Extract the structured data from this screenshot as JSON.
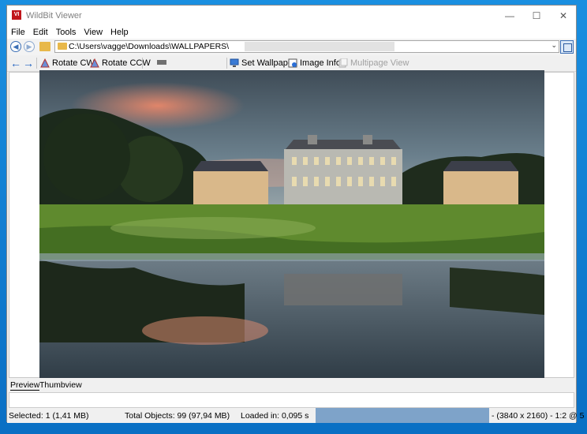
{
  "window": {
    "title": "WildBit Viewer",
    "app_icon_text": "VI",
    "controls": {
      "minimize": "—",
      "maximize": "☐",
      "close": "✕"
    }
  },
  "menu": [
    "File",
    "Edit",
    "Tools",
    "View",
    "Help"
  ],
  "address": {
    "path": "C:\\Users\\vagge\\Downloads\\WALLPAPERS\\",
    "dropdown": "⌄"
  },
  "toolbar": {
    "back": "←",
    "forward": "→",
    "rotate_cw": "Rotate CW",
    "rotate_ccw": "Rotate CCW",
    "set_wallpaper": "Set Wallpaper",
    "image_info": "Image Info",
    "multipage_view": "Multipage View"
  },
  "tabs": [
    "Preview",
    "Thumbview"
  ],
  "status": {
    "selected": "Selected: 1 (1,41 MB)",
    "total": "Total Objects: 99 (97,94 MB)",
    "loaded": "Loaded in: 0,095 s",
    "dims": "- (3840 x 2160) - 1:2 @ 5"
  },
  "colors": {
    "accent": "#1d5fbf",
    "desktop": "#1a8fe0"
  }
}
